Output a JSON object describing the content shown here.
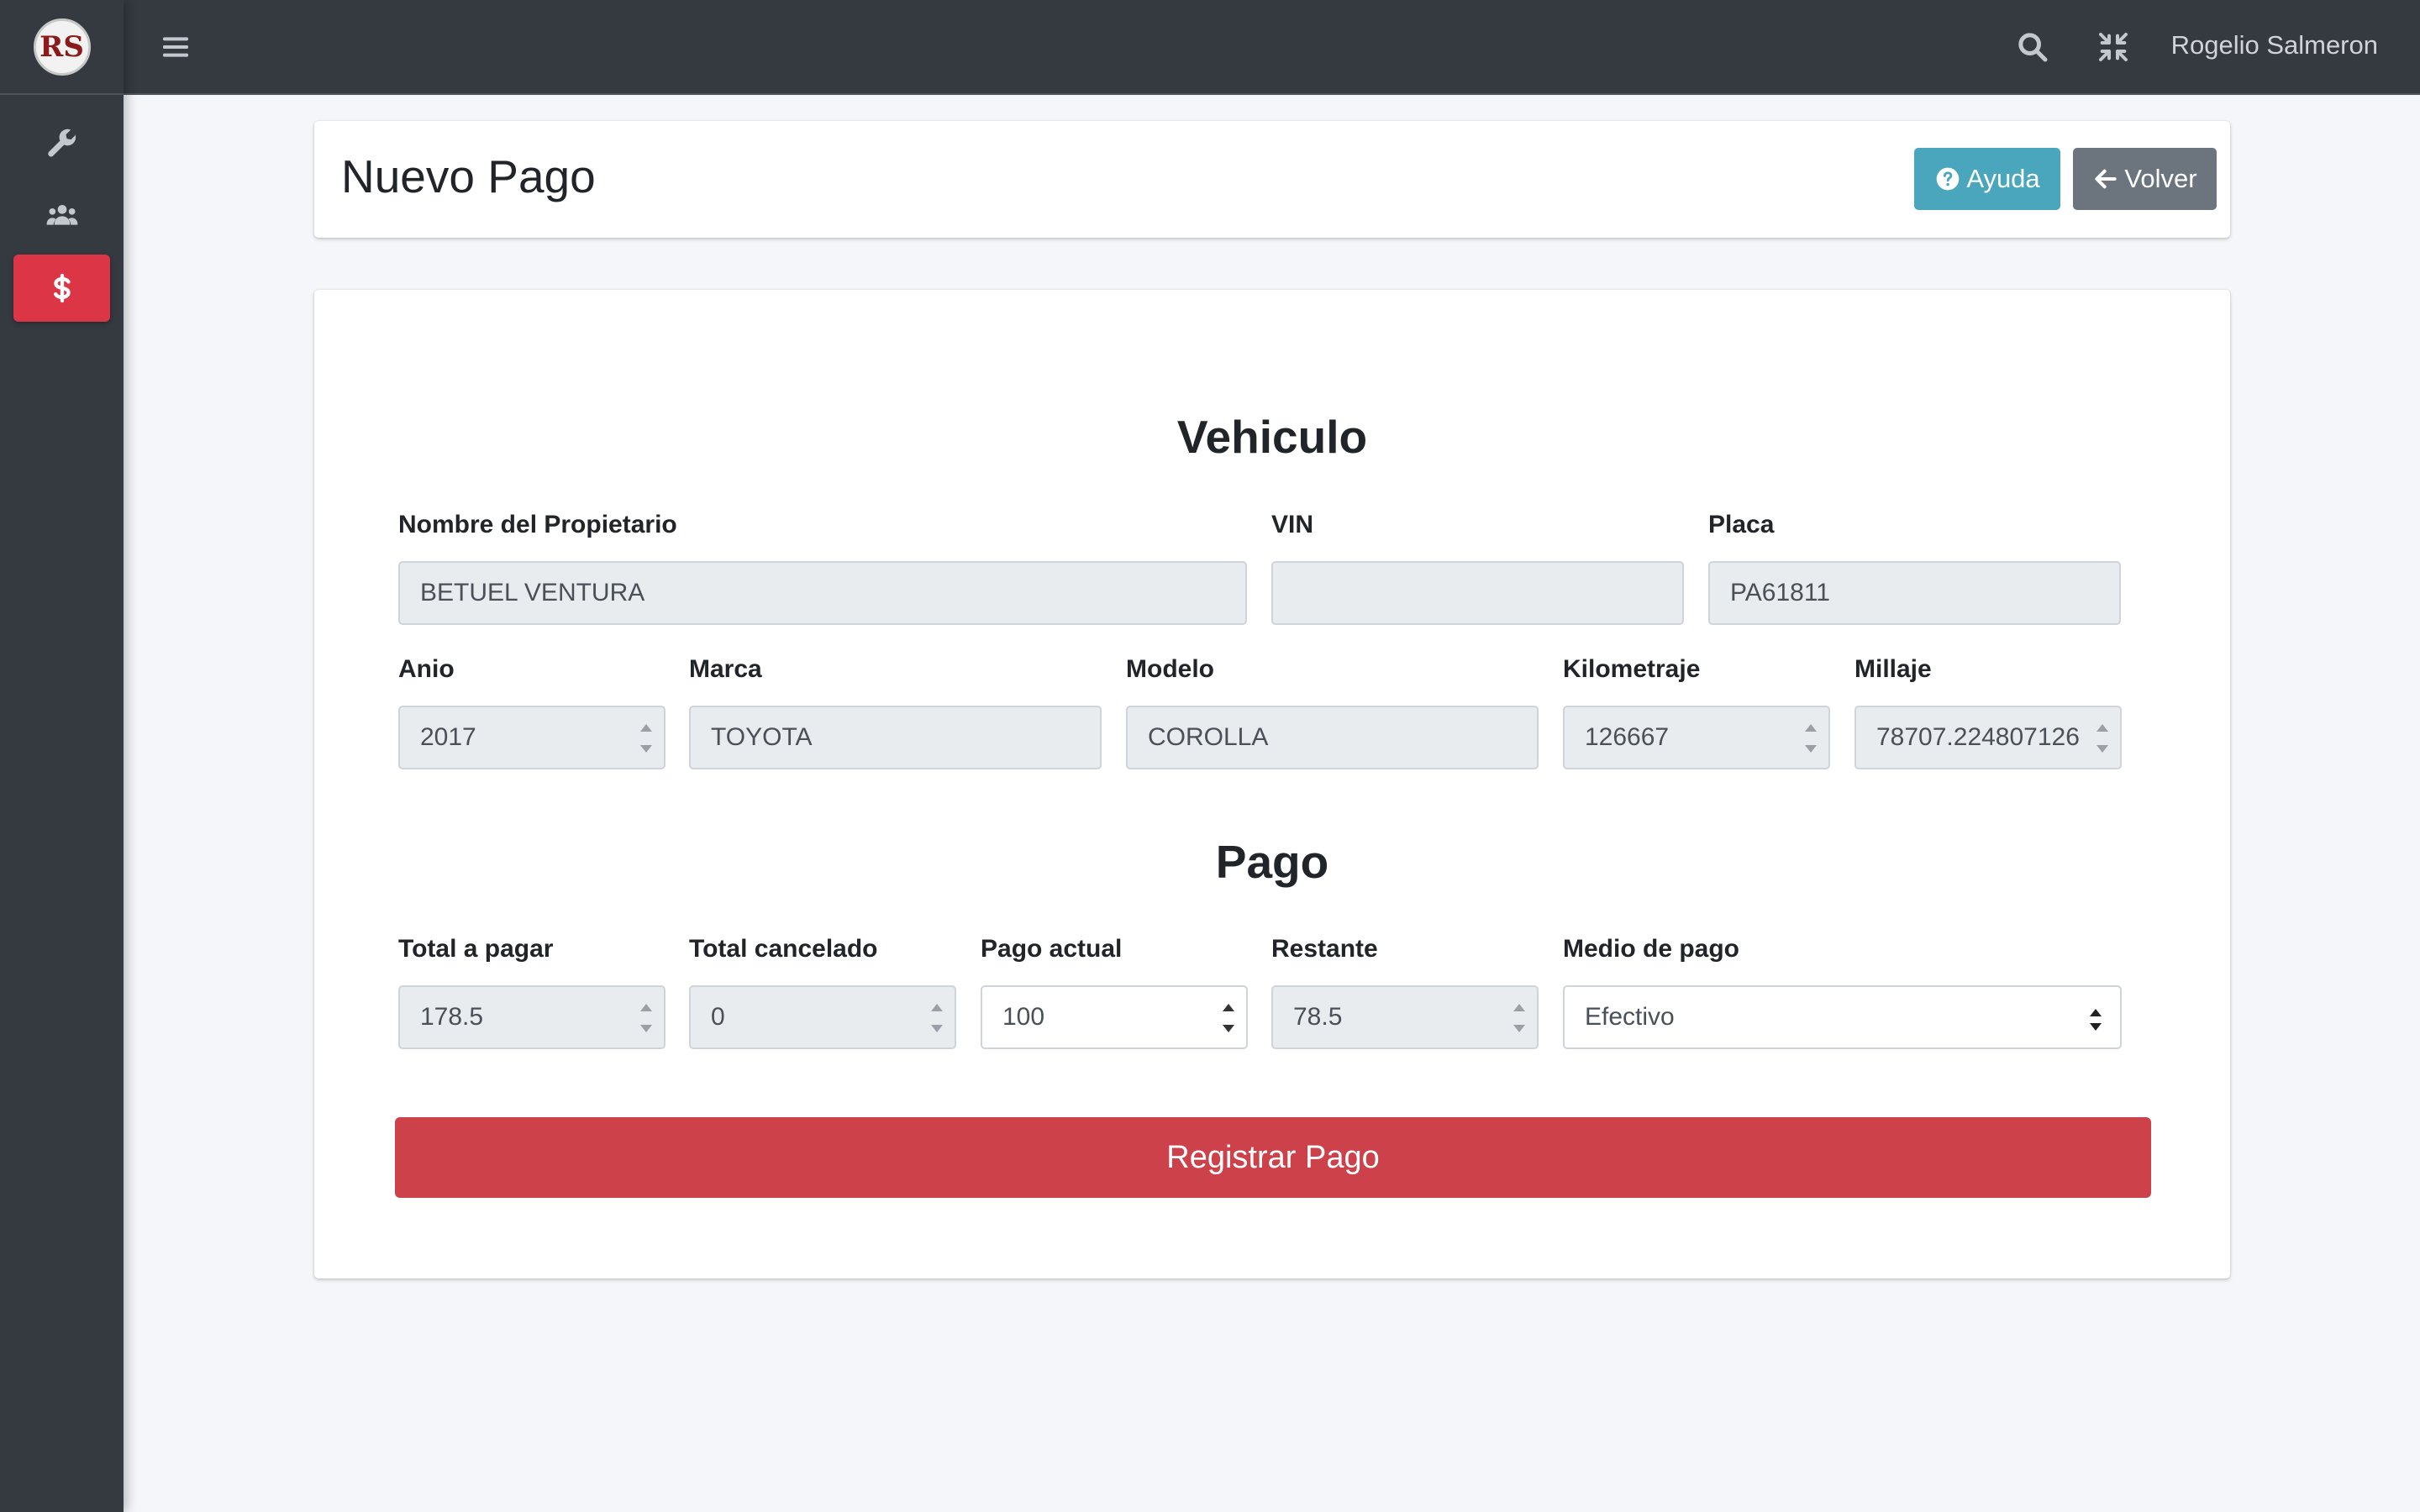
{
  "app": {
    "logo_text": "RS",
    "user_name": "Rogelio Salmeron"
  },
  "sidebar": {
    "items": [
      {
        "icon": "wrench-icon"
      },
      {
        "icon": "users-icon"
      },
      {
        "icon": "dollar-icon",
        "active": true
      }
    ]
  },
  "header": {
    "title": "Nuevo Pago",
    "help_label": "Ayuda",
    "back_label": "Volver"
  },
  "vehiculo": {
    "title": "Vehiculo",
    "propietario_label": "Nombre del Propietario",
    "propietario_value": "BETUEL VENTURA",
    "vin_label": "VIN",
    "vin_value": "",
    "placa_label": "Placa",
    "placa_value": "PA61811",
    "anio_label": "Anio",
    "anio_value": "2017",
    "marca_label": "Marca",
    "marca_value": "TOYOTA",
    "modelo_label": "Modelo",
    "modelo_value": "COROLLA",
    "kilometraje_label": "Kilometraje",
    "kilometraje_value": "126667",
    "millaje_label": "Millaje",
    "millaje_value": "78707.224807126"
  },
  "pago": {
    "title": "Pago",
    "total_label": "Total a pagar",
    "total_value": "178.5",
    "cancelado_label": "Total cancelado",
    "cancelado_value": "0",
    "actual_label": "Pago actual",
    "actual_value": "100",
    "restante_label": "Restante",
    "restante_value": "78.5",
    "medio_label": "Medio de pago",
    "medio_value": "Efectivo",
    "submit_label": "Registrar Pago"
  },
  "colors": {
    "sidebar": "#343a40",
    "danger": "#dc3545",
    "info": "#4aa6bd",
    "secondary": "#6c757d"
  }
}
